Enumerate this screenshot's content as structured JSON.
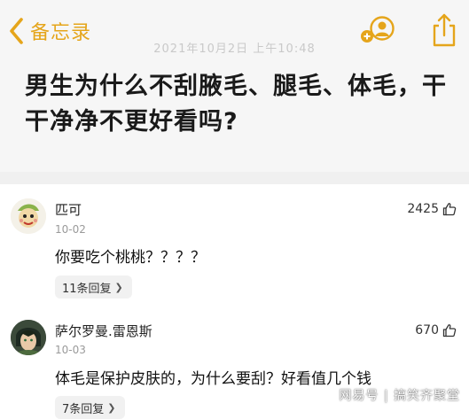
{
  "nav": {
    "back_label": "备忘录"
  },
  "note": {
    "date": "2021年10月2日 上午10:48",
    "title": "男生为什么不刮腋毛、腿毛、体毛，干干净净不更好看吗?"
  },
  "comments": [
    {
      "name": "匹可",
      "date": "10-02",
      "text": "你要吃个桃桃？？？？",
      "likes": "2425",
      "replies": "11条回复"
    },
    {
      "name": "萨尔罗曼.雷恩斯",
      "date": "10-03",
      "text": "体毛是保护皮肤的，为什么要刮？好看值几个钱",
      "likes": "670",
      "replies": "7条回复"
    }
  ],
  "watermark": "网易号 | 搞笑齐聚堂",
  "colors": {
    "accent": "#e5a51b",
    "notes_bg": "#f6f6f6",
    "pill_bg": "#f1f1f1"
  },
  "icons": [
    "back-chevron-icon",
    "share-people-icon",
    "share-out-icon",
    "thumbs-up-icon",
    "chevron-right-icon"
  ]
}
